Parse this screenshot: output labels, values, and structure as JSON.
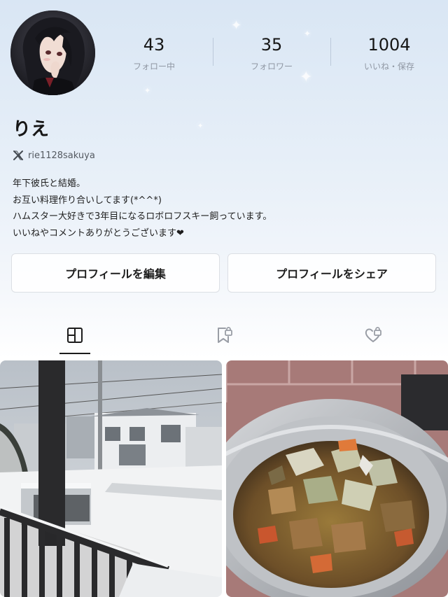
{
  "profile": {
    "stats": [
      {
        "count": "43",
        "label": "フォロー中"
      },
      {
        "count": "35",
        "label": "フォロワー"
      },
      {
        "count": "1004",
        "label": "いいね・保存"
      }
    ],
    "name": "りえ",
    "social_handle": "rie1128sakuya",
    "bio": [
      "年下彼氏と結婚。",
      "お互い料理作り合いしてます(*^^*)",
      "ハムスター大好きで3年目になるロボロフスキー飼っています。",
      "いいねやコメントありがとうございます❤"
    ]
  },
  "buttons": {
    "edit": "プロフィールを編集",
    "share": "プロフィールをシェア"
  },
  "tabs": [
    {
      "icon": "grid-icon",
      "active": true
    },
    {
      "icon": "bookmark-lock-icon",
      "active": false
    },
    {
      "icon": "heart-lock-icon",
      "active": false
    }
  ],
  "posts": [
    {
      "subject": "snowy-street-photo"
    },
    {
      "subject": "stew-pot-photo"
    }
  ],
  "colors": {
    "header_gradient_top": "#d9e6f4",
    "text_primary": "#1c1c1c",
    "text_secondary": "#8f97a3",
    "button_border": "#dcdfe4"
  }
}
